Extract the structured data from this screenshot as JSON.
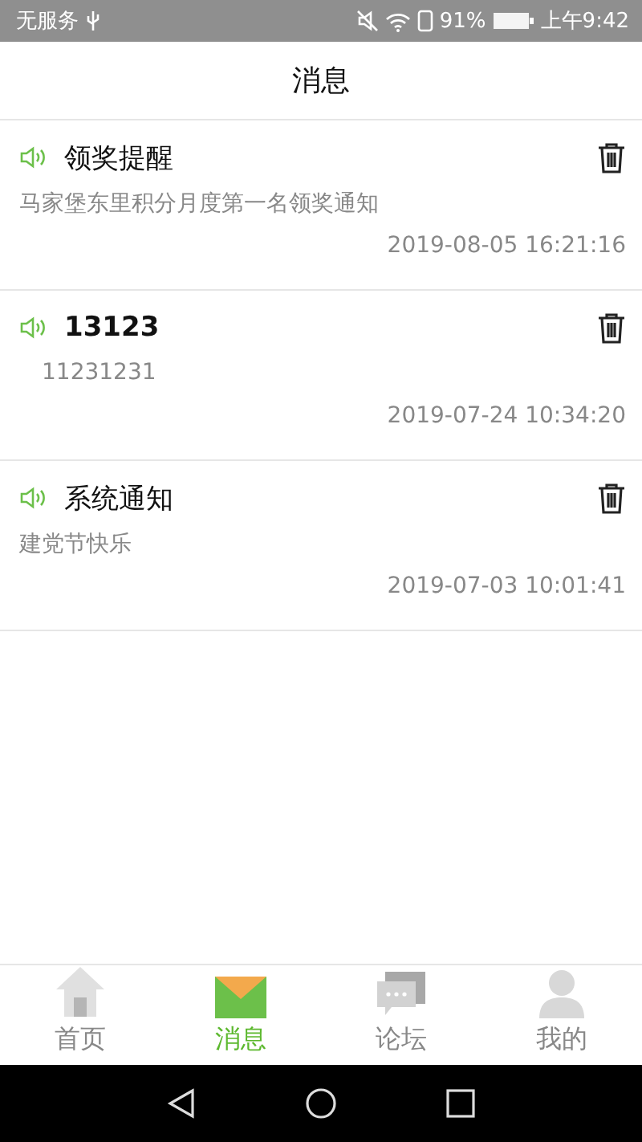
{
  "status_bar": {
    "carrier": "无服务",
    "battery": "91%",
    "time": "上午9:42"
  },
  "header": {
    "title": "消息"
  },
  "messages": [
    {
      "title": "领奖提醒",
      "bold": false,
      "indented": false,
      "body": "马家堡东里积分月度第一名领奖通知",
      "time": "2019-08-05 16:21:16"
    },
    {
      "title": "13123",
      "bold": true,
      "indented": true,
      "body": "11231231",
      "time": "2019-07-24 10:34:20"
    },
    {
      "title": "系统通知",
      "bold": false,
      "indented": false,
      "body": "建党节快乐",
      "time": "2019-07-03 10:01:41"
    }
  ],
  "tab_bar": [
    {
      "kind": "home",
      "label": "首页",
      "selected": false
    },
    {
      "kind": "mail",
      "label": "消息",
      "selected": true
    },
    {
      "kind": "forum",
      "label": "论坛",
      "selected": false
    },
    {
      "kind": "profile",
      "label": "我的",
      "selected": false
    }
  ]
}
